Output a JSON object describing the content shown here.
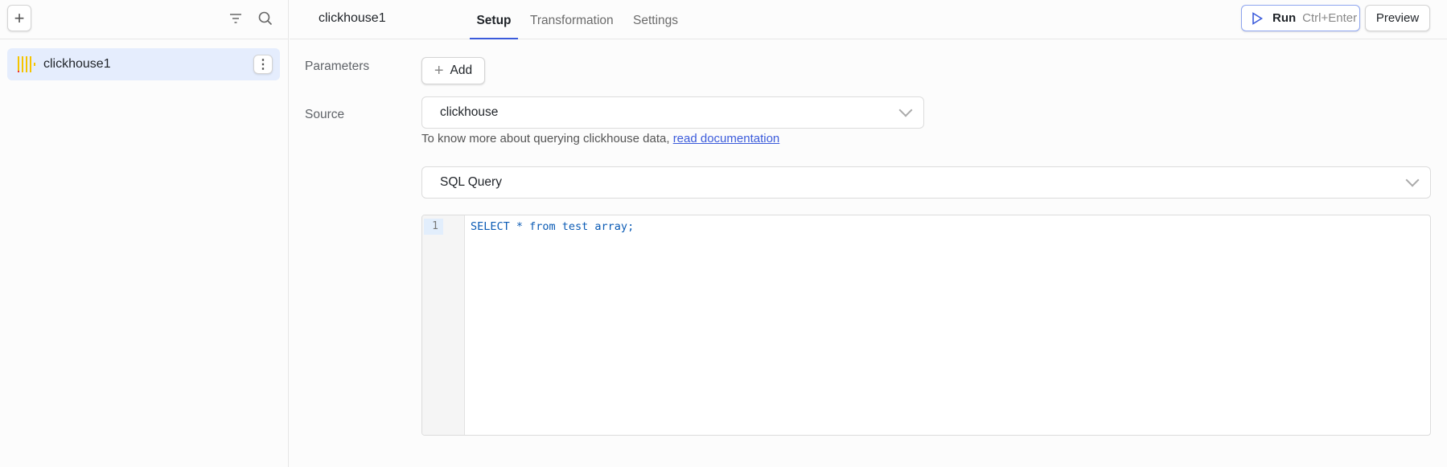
{
  "sidebar": {
    "items": [
      {
        "label": "clickhouse1"
      }
    ]
  },
  "header": {
    "title": "clickhouse1",
    "tabs": [
      {
        "label": "Setup"
      },
      {
        "label": "Transformation"
      },
      {
        "label": "Settings"
      }
    ],
    "run_label": "Run",
    "run_shortcut": "Ctrl+Enter",
    "preview_label": "Preview"
  },
  "form": {
    "parameters_label": "Parameters",
    "add_label": "Add",
    "source_label": "Source",
    "source_value": "clickhouse",
    "help_text": "To know more about querying clickhouse data, ",
    "help_link": "read documentation",
    "query_mode": "SQL Query"
  },
  "editor": {
    "line_number": "1",
    "code": "SELECT * from test array;"
  },
  "colors": {
    "accent": "#3b5bdb",
    "code": "#0b5bb5"
  }
}
